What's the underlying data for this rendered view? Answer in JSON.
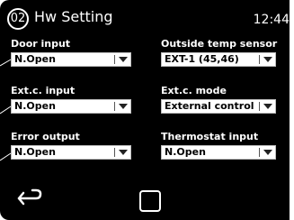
{
  "header": {
    "page_number": "02",
    "title": "Hw Setting",
    "clock": "12:44"
  },
  "fields": {
    "door_input": {
      "label": "Door input",
      "value": "N.Open"
    },
    "outside_temp_sensor": {
      "label": "Outside temp sensor",
      "value": "EXT-1 (45,46)"
    },
    "ext_c_input": {
      "label": "Ext.c. input",
      "value": "N.Open"
    },
    "ext_c_mode": {
      "label": "Ext.c. mode",
      "value": "External control"
    },
    "error_output": {
      "label": "Error output",
      "value": "N.Open"
    },
    "thermostat_input": {
      "label": "Thermostat input",
      "value": "N.Open"
    }
  },
  "icons": {
    "back": "back-arrow-icon",
    "home": "square-home-icon",
    "dropdown": "chevron-down-icon"
  },
  "colors": {
    "screen_background": "#000000",
    "text": "#ffffff",
    "dropdown_background": "#ffffff",
    "dropdown_text": "#000000"
  }
}
